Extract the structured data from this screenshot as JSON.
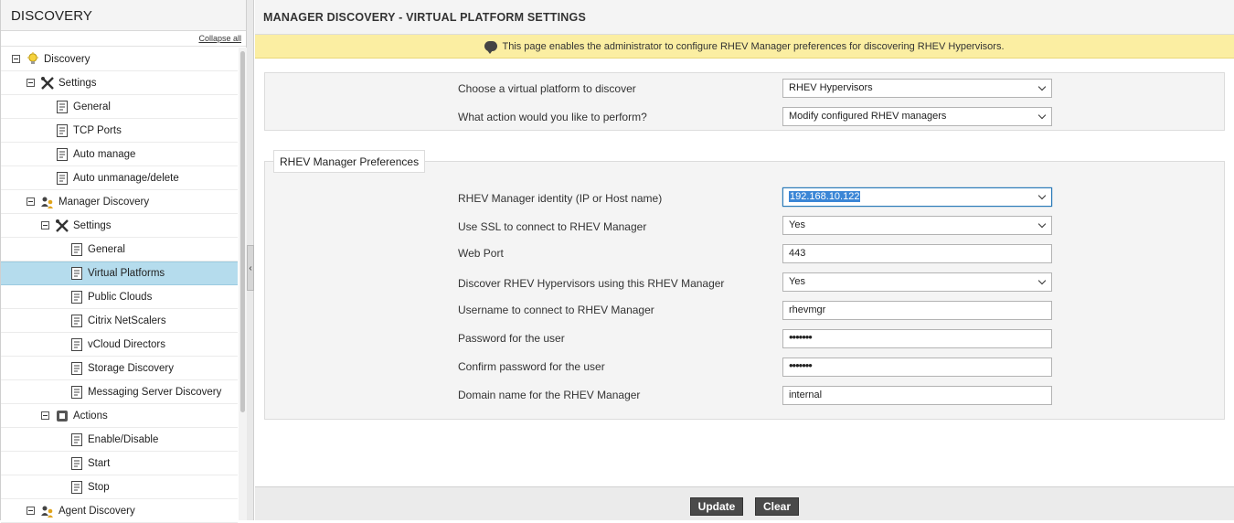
{
  "sidebar": {
    "title": "DISCOVERY",
    "collapse_label": "Collapse all",
    "items": [
      {
        "label": "Discovery",
        "icon": "bulb-icon"
      },
      {
        "label": "Settings",
        "icon": "tools-icon"
      },
      {
        "label": "General",
        "icon": "document-icon"
      },
      {
        "label": "TCP Ports",
        "icon": "document-icon"
      },
      {
        "label": "Auto manage",
        "icon": "document-icon"
      },
      {
        "label": "Auto unmanage/delete",
        "icon": "document-icon"
      },
      {
        "label": "Manager Discovery",
        "icon": "users-icon"
      },
      {
        "label": "Settings",
        "icon": "tools-icon"
      },
      {
        "label": "General",
        "icon": "document-icon"
      },
      {
        "label": "Virtual Platforms",
        "icon": "document-icon"
      },
      {
        "label": "Public Clouds",
        "icon": "document-icon"
      },
      {
        "label": "Citrix NetScalers",
        "icon": "document-icon"
      },
      {
        "label": "vCloud Directors",
        "icon": "document-icon"
      },
      {
        "label": "Storage Discovery",
        "icon": "document-icon"
      },
      {
        "label": "Messaging Server Discovery",
        "icon": "document-icon"
      },
      {
        "label": "Actions",
        "icon": "action-icon"
      },
      {
        "label": "Enable/Disable",
        "icon": "document-icon"
      },
      {
        "label": "Start",
        "icon": "document-icon"
      },
      {
        "label": "Stop",
        "icon": "document-icon"
      },
      {
        "label": "Agent Discovery",
        "icon": "users-icon"
      }
    ],
    "selected": "Virtual Platforms"
  },
  "main": {
    "title": "MANAGER DISCOVERY - VIRTUAL PLATFORM SETTINGS",
    "info": "This page enables the administrator to configure RHEV Manager preferences for discovering RHEV Hypervisors.",
    "platform": {
      "label": "Choose a virtual platform to discover",
      "value": "RHEV Hypervisors"
    },
    "action": {
      "label": "What action would you like to perform?",
      "value": "Modify configured RHEV managers"
    },
    "prefs_legend": "RHEV Manager Preferences",
    "fields": {
      "identity": {
        "label": "RHEV Manager identity (IP or Host name)",
        "value": "192.168.10.122"
      },
      "ssl": {
        "label": "Use SSL to connect to RHEV Manager",
        "value": "Yes"
      },
      "port": {
        "label": "Web Port",
        "value": "443"
      },
      "discover": {
        "label": "Discover RHEV Hypervisors using this RHEV Manager",
        "value": "Yes"
      },
      "username": {
        "label": "Username to connect to RHEV Manager",
        "value": "rhevmgr"
      },
      "password": {
        "label": "Password for the user",
        "value": "•••••••"
      },
      "confirm": {
        "label": "Confirm password for the user",
        "value": "•••••••"
      },
      "domain": {
        "label": "Domain name for the RHEV Manager",
        "value": "internal"
      }
    },
    "buttons": {
      "update": "Update",
      "clear": "Clear"
    }
  }
}
